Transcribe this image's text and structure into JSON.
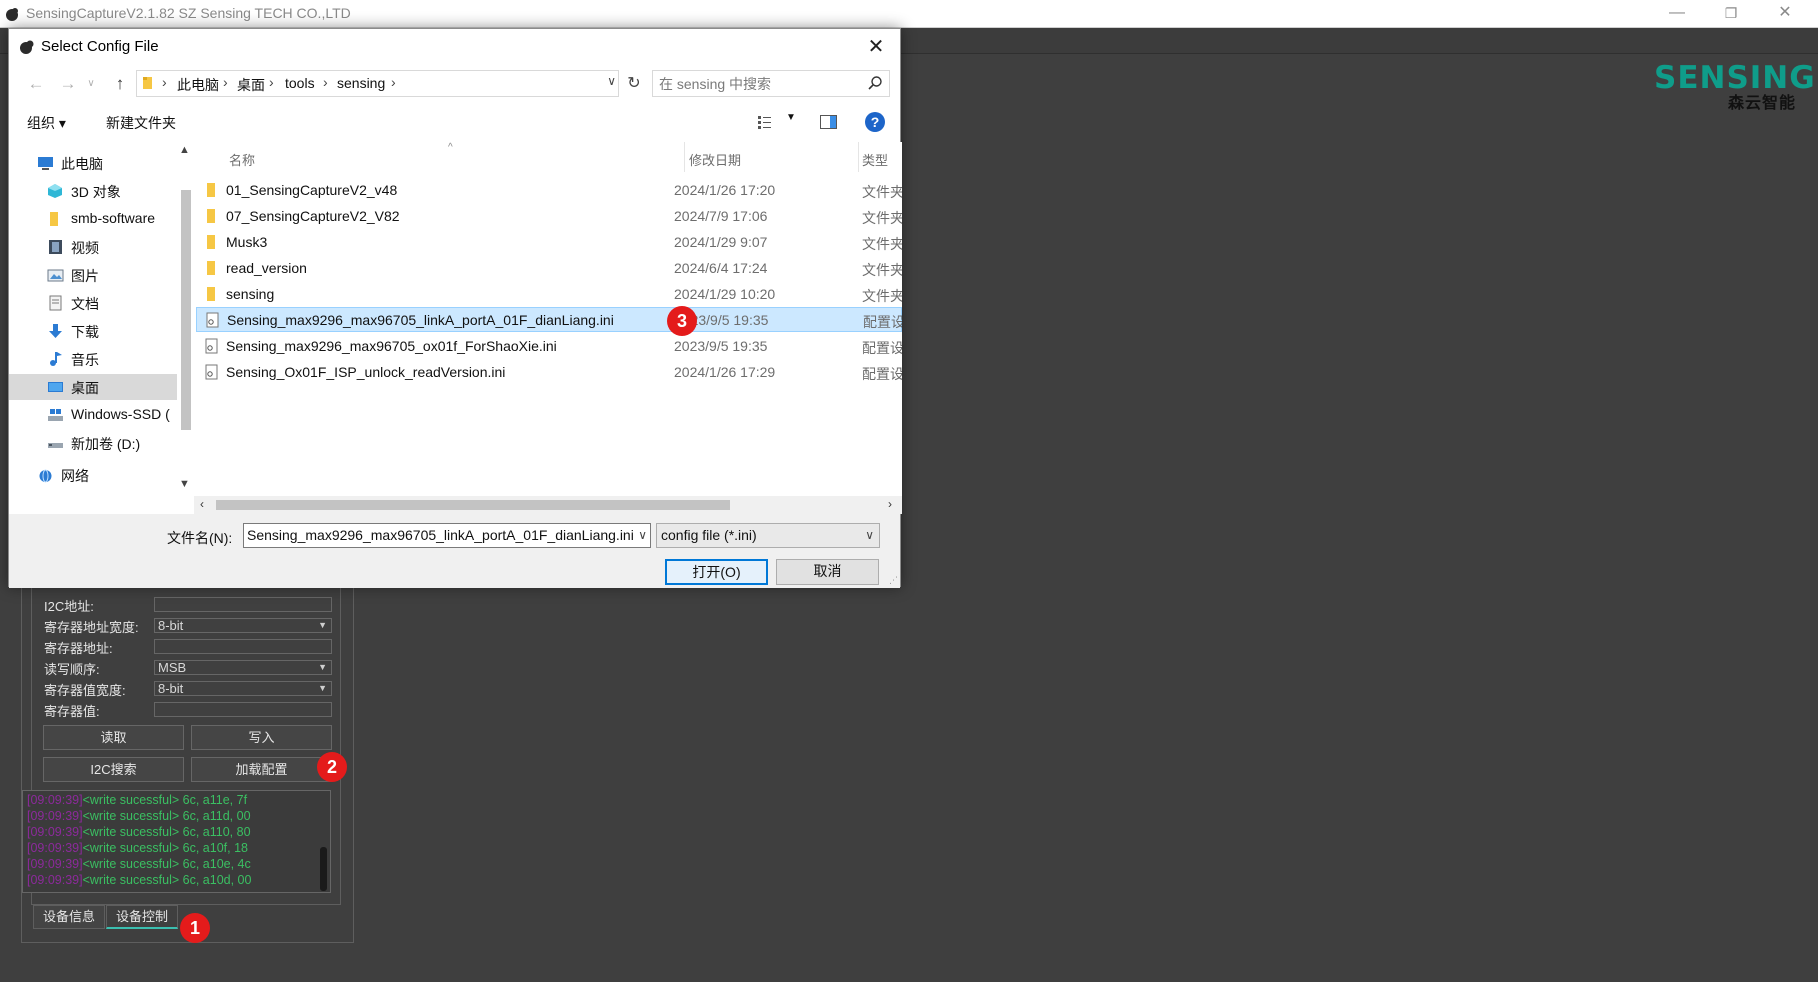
{
  "app": {
    "title": "SensingCaptureV2.1.82 SZ Sensing TECH CO.,LTD",
    "window_buttons": {
      "minimize": "—",
      "restore": "❐",
      "close": "✕"
    },
    "brand": {
      "top": "SENSING",
      "sub": "森云智能",
      "color": "#0f9d8a"
    }
  },
  "control_panel": {
    "fields": [
      {
        "label": "I2C地址:",
        "value": ""
      },
      {
        "label": "寄存器地址宽度:",
        "value": "8-bit"
      },
      {
        "label": "寄存器地址:",
        "value": ""
      },
      {
        "label": "读写顺序:",
        "value": "MSB"
      },
      {
        "label": "寄存器值宽度:",
        "value": "8-bit"
      },
      {
        "label": "寄存器值:",
        "value": ""
      }
    ],
    "buttons": {
      "read": "读取",
      "write": "写入",
      "i2c_search": "I2C搜索",
      "load_config": "加载配置"
    },
    "log": [
      {
        "ts": "[09:09:39]",
        "msg": "<write sucessful> 6c, a11e, 7f"
      },
      {
        "ts": "[09:09:39]",
        "msg": "<write sucessful> 6c, a11d, 00"
      },
      {
        "ts": "[09:09:39]",
        "msg": "<write sucessful> 6c, a110, 80"
      },
      {
        "ts": "[09:09:39]",
        "msg": "<write sucessful> 6c, a10f, 18"
      },
      {
        "ts": "[09:09:39]",
        "msg": "<write sucessful> 6c, a10e, 4c"
      },
      {
        "ts": "[09:09:39]",
        "msg": "<write sucessful> 6c, a10d, 00"
      }
    ],
    "tabs": [
      {
        "label": "设备信息"
      },
      {
        "label": "设备控制"
      }
    ],
    "active_tab": "设备控制"
  },
  "markers": {
    "one": "1",
    "two": "2",
    "three": "3"
  },
  "dialog": {
    "title": "Select Config File",
    "close": "✕",
    "breadcrumb": [
      "此电脑",
      "桌面",
      "tools",
      "sensing"
    ],
    "search_placeholder": "在 sensing 中搜索",
    "toolbar": {
      "organize": "组织 ▾",
      "new_folder": "新建文件夹",
      "help": "?"
    },
    "nav_items": [
      {
        "label": "此电脑",
        "icon": "pc-icon"
      },
      {
        "label": "3D 对象",
        "icon": "3d-objects-icon"
      },
      {
        "label": "smb-software",
        "icon": "folder-icon"
      },
      {
        "label": "视频",
        "icon": "video-icon"
      },
      {
        "label": "图片",
        "icon": "pictures-icon"
      },
      {
        "label": "文档",
        "icon": "documents-icon"
      },
      {
        "label": "下载",
        "icon": "download-icon"
      },
      {
        "label": "音乐",
        "icon": "music-icon"
      },
      {
        "label": "桌面",
        "icon": "desktop-icon"
      },
      {
        "label": "Windows-SSD (",
        "icon": "drive-icon"
      },
      {
        "label": "新加卷 (D:)",
        "icon": "drive-icon"
      },
      {
        "label": "网络",
        "icon": "network-icon"
      }
    ],
    "selected_nav": "桌面",
    "columns": {
      "name": "名称",
      "date": "修改日期",
      "type": "类型"
    },
    "files": [
      {
        "name": "01_SensingCaptureV2_v48",
        "date": "2024/1/26 17:20",
        "type": "文件夹",
        "kind": "folder"
      },
      {
        "name": "07_SensingCaptureV2_V82",
        "date": "2024/7/9 17:06",
        "type": "文件夹",
        "kind": "folder"
      },
      {
        "name": "Musk3",
        "date": "2024/1/29 9:07",
        "type": "文件夹",
        "kind": "folder"
      },
      {
        "name": "read_version",
        "date": "2024/6/4 17:24",
        "type": "文件夹",
        "kind": "folder"
      },
      {
        "name": "sensing",
        "date": "2024/1/29 10:20",
        "type": "文件夹",
        "kind": "folder"
      },
      {
        "name": "Sensing_max9296_max96705_linkA_portA_01F_dianLiang.ini",
        "date": "2023/9/5 19:35",
        "type": "配置设置",
        "kind": "ini",
        "selected": true
      },
      {
        "name": "Sensing_max9296_max96705_ox01f_ForShaoXie.ini",
        "date": "2023/9/5 19:35",
        "type": "配置设置",
        "kind": "ini"
      },
      {
        "name": "Sensing_Ox01F_ISP_unlock_readVersion.ini",
        "date": "2024/1/26 17:29",
        "type": "配置设置",
        "kind": "ini"
      }
    ],
    "filename_label": "文件名(N):",
    "filename_value": "Sensing_max9296_max96705_linkA_portA_01F_dianLiang.ini",
    "filter": "config file (*.ini)",
    "open_button": "打开(O)",
    "cancel_button": "取消"
  }
}
